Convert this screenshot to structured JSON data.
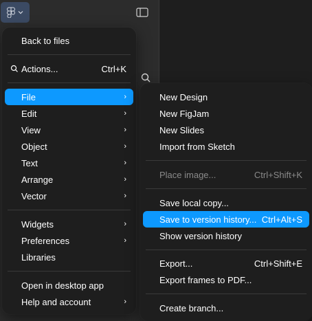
{
  "theme": {
    "accent": "#0d99ff",
    "menu_bg": "#1e1e1e",
    "panel_bg": "#2c2c2c"
  },
  "main_menu": {
    "back": "Back to files",
    "actions": {
      "label": "Actions...",
      "shortcut": "Ctrl+K"
    },
    "file": "File",
    "edit": "Edit",
    "view": "View",
    "object": "Object",
    "text": "Text",
    "arrange": "Arrange",
    "vector": "Vector",
    "widgets": "Widgets",
    "preferences": "Preferences",
    "libraries": "Libraries",
    "open_desktop": "Open in desktop app",
    "help": "Help and account"
  },
  "file_menu": {
    "new_design": "New Design",
    "new_figjam": "New FigJam",
    "new_slides": "New Slides",
    "import_sketch": "Import from Sketch",
    "place_image": {
      "label": "Place image...",
      "shortcut": "Ctrl+Shift+K"
    },
    "save_local": "Save local copy...",
    "save_version": {
      "label": "Save to version history...",
      "shortcut": "Ctrl+Alt+S"
    },
    "show_history": "Show version history",
    "export": {
      "label": "Export...",
      "shortcut": "Ctrl+Shift+E"
    },
    "export_frames": "Export frames to PDF...",
    "create_branch": "Create branch..."
  }
}
